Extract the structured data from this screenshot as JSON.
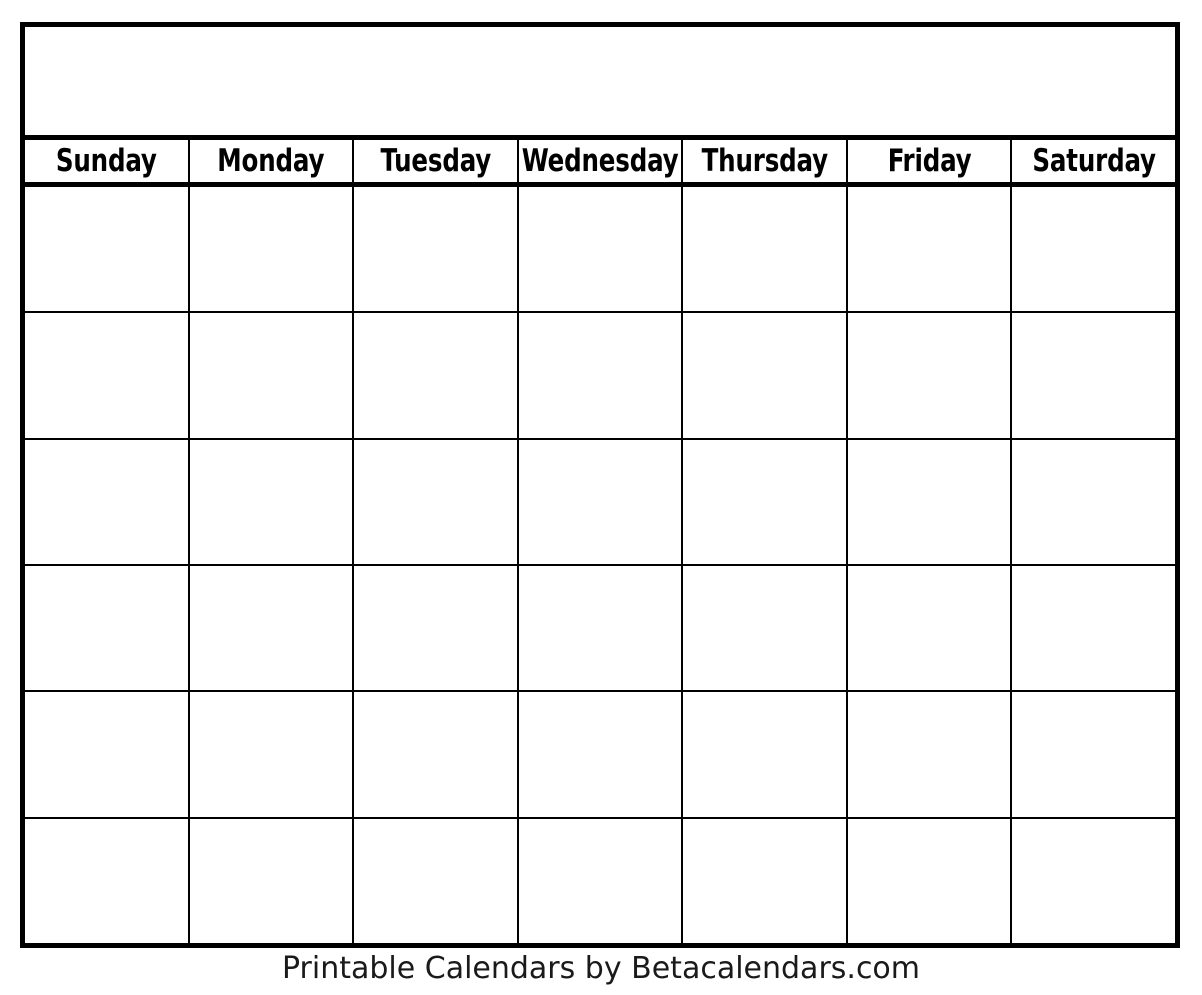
{
  "page": {
    "background_color": "#ffffff",
    "ink_color": "#000000",
    "document_type": "blank printable monthly calendar template"
  },
  "title_banner": {
    "name": "month-year-title",
    "text": "",
    "is_blank": true
  },
  "weekday_header": {
    "days": [
      {
        "label": "Sunday"
      },
      {
        "label": "Monday"
      },
      {
        "label": "Tuesday"
      },
      {
        "label": "Wednesday"
      },
      {
        "label": "Thursday"
      },
      {
        "label": "Friday"
      },
      {
        "label": "Saturday"
      }
    ]
  },
  "grid": {
    "columns": 7,
    "rows": 6,
    "cells_blank": true,
    "weeks": [
      {
        "days": [
          "",
          "",
          "",
          "",
          "",
          "",
          ""
        ]
      },
      {
        "days": [
          "",
          "",
          "",
          "",
          "",
          "",
          ""
        ]
      },
      {
        "days": [
          "",
          "",
          "",
          "",
          "",
          "",
          ""
        ]
      },
      {
        "days": [
          "",
          "",
          "",
          "",
          "",
          "",
          ""
        ]
      },
      {
        "days": [
          "",
          "",
          "",
          "",
          "",
          "",
          ""
        ]
      },
      {
        "days": [
          "",
          "",
          "",
          "",
          "",
          "",
          ""
        ]
      }
    ]
  },
  "footer": {
    "credit": "Printable Calendars by Betacalendars.com"
  }
}
